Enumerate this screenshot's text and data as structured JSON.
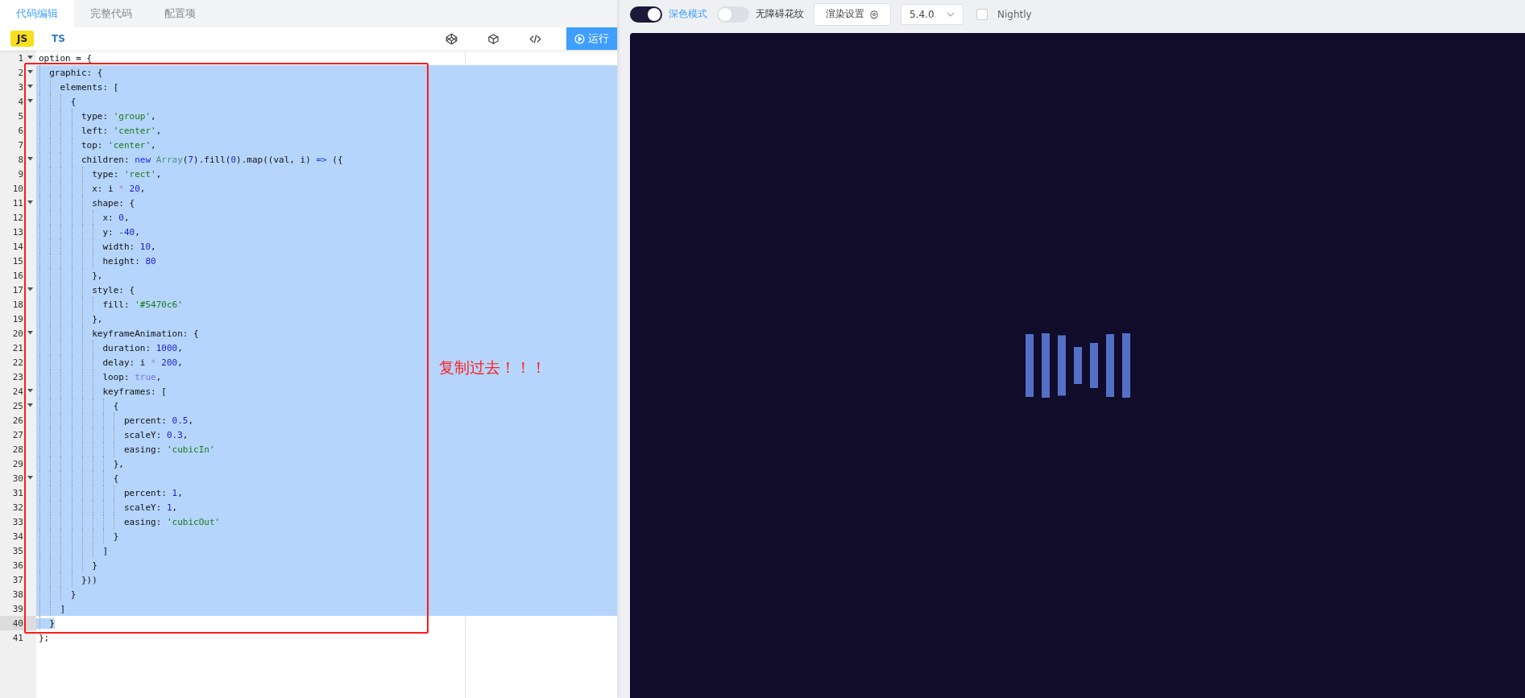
{
  "editor_tabs": [
    {
      "label": "代码编辑",
      "selected": true
    },
    {
      "label": "完整代码",
      "selected": false
    },
    {
      "label": "配置项",
      "selected": false
    }
  ],
  "languages": [
    {
      "label": "JS",
      "selected": true
    },
    {
      "label": "TS",
      "selected": false
    }
  ],
  "run_button": {
    "label": "运行"
  },
  "code_lines": [
    {
      "number": "1",
      "foldable": true,
      "selected": false,
      "cursor": false,
      "tokens": [
        {
          "kind": "plain",
          "text": "option = {"
        }
      ]
    },
    {
      "number": "2",
      "foldable": true,
      "selected": true,
      "cursor": false,
      "tokens": [
        {
          "kind": "plain",
          "text": "  graphic: {"
        }
      ]
    },
    {
      "number": "3",
      "foldable": true,
      "selected": true,
      "cursor": false,
      "tokens": [
        {
          "kind": "plain",
          "text": "    elements: ["
        }
      ]
    },
    {
      "number": "4",
      "foldable": true,
      "selected": true,
      "cursor": false,
      "tokens": [
        {
          "kind": "plain",
          "text": "      {"
        }
      ]
    },
    {
      "number": "5",
      "foldable": false,
      "selected": true,
      "cursor": false,
      "tokens": [
        {
          "kind": "plain",
          "text": "        type: "
        },
        {
          "kind": "string",
          "text": "'group'"
        },
        {
          "kind": "plain",
          "text": ","
        }
      ]
    },
    {
      "number": "6",
      "foldable": false,
      "selected": true,
      "cursor": false,
      "tokens": [
        {
          "kind": "plain",
          "text": "        left: "
        },
        {
          "kind": "string",
          "text": "'center'"
        },
        {
          "kind": "plain",
          "text": ","
        }
      ]
    },
    {
      "number": "7",
      "foldable": false,
      "selected": true,
      "cursor": false,
      "tokens": [
        {
          "kind": "plain",
          "text": "        top: "
        },
        {
          "kind": "string",
          "text": "'center'"
        },
        {
          "kind": "plain",
          "text": ","
        }
      ]
    },
    {
      "number": "8",
      "foldable": true,
      "selected": true,
      "cursor": false,
      "tokens": [
        {
          "kind": "plain",
          "text": "        children: "
        },
        {
          "kind": "keyword",
          "text": "new"
        },
        {
          "kind": "builtin",
          "text": " Array"
        },
        {
          "kind": "plain",
          "text": "("
        },
        {
          "kind": "number",
          "text": "7"
        },
        {
          "kind": "plain",
          "text": ").fill("
        },
        {
          "kind": "number",
          "text": "0"
        },
        {
          "kind": "plain",
          "text": ").map((val, i) "
        },
        {
          "kind": "keyword",
          "text": "=>"
        },
        {
          "kind": "plain",
          "text": " ({"
        }
      ]
    },
    {
      "number": "9",
      "foldable": false,
      "selected": true,
      "cursor": false,
      "tokens": [
        {
          "kind": "plain",
          "text": "          type: "
        },
        {
          "kind": "string",
          "text": "'rect'"
        },
        {
          "kind": "plain",
          "text": ","
        }
      ]
    },
    {
      "number": "10",
      "foldable": false,
      "selected": true,
      "cursor": false,
      "tokens": [
        {
          "kind": "plain",
          "text": "          x: i "
        },
        {
          "kind": "operator",
          "text": "*"
        },
        {
          "kind": "number",
          "text": " 20"
        },
        {
          "kind": "plain",
          "text": ","
        }
      ]
    },
    {
      "number": "11",
      "foldable": true,
      "selected": true,
      "cursor": false,
      "tokens": [
        {
          "kind": "plain",
          "text": "          shape: {"
        }
      ]
    },
    {
      "number": "12",
      "foldable": false,
      "selected": true,
      "cursor": false,
      "tokens": [
        {
          "kind": "plain",
          "text": "            x: "
        },
        {
          "kind": "number",
          "text": "0"
        },
        {
          "kind": "plain",
          "text": ","
        }
      ]
    },
    {
      "number": "13",
      "foldable": false,
      "selected": true,
      "cursor": false,
      "tokens": [
        {
          "kind": "plain",
          "text": "            y: "
        },
        {
          "kind": "number",
          "text": "-40"
        },
        {
          "kind": "plain",
          "text": ","
        }
      ]
    },
    {
      "number": "14",
      "foldable": false,
      "selected": true,
      "cursor": false,
      "tokens": [
        {
          "kind": "plain",
          "text": "            width: "
        },
        {
          "kind": "number",
          "text": "10"
        },
        {
          "kind": "plain",
          "text": ","
        }
      ]
    },
    {
      "number": "15",
      "foldable": false,
      "selected": true,
      "cursor": false,
      "tokens": [
        {
          "kind": "plain",
          "text": "            height: "
        },
        {
          "kind": "number",
          "text": "80"
        }
      ]
    },
    {
      "number": "16",
      "foldable": false,
      "selected": true,
      "cursor": false,
      "tokens": [
        {
          "kind": "plain",
          "text": "          },"
        }
      ]
    },
    {
      "number": "17",
      "foldable": true,
      "selected": true,
      "cursor": false,
      "tokens": [
        {
          "kind": "plain",
          "text": "          style: {"
        }
      ]
    },
    {
      "number": "18",
      "foldable": false,
      "selected": true,
      "cursor": false,
      "tokens": [
        {
          "kind": "plain",
          "text": "            fill: "
        },
        {
          "kind": "string",
          "text": "'#5470c6'"
        }
      ]
    },
    {
      "number": "19",
      "foldable": false,
      "selected": true,
      "cursor": false,
      "tokens": [
        {
          "kind": "plain",
          "text": "          },"
        }
      ]
    },
    {
      "number": "20",
      "foldable": true,
      "selected": true,
      "cursor": false,
      "tokens": [
        {
          "kind": "plain",
          "text": "          keyframeAnimation: {"
        }
      ]
    },
    {
      "number": "21",
      "foldable": false,
      "selected": true,
      "cursor": false,
      "tokens": [
        {
          "kind": "plain",
          "text": "            duration: "
        },
        {
          "kind": "number",
          "text": "1000"
        },
        {
          "kind": "plain",
          "text": ","
        }
      ]
    },
    {
      "number": "22",
      "foldable": false,
      "selected": true,
      "cursor": false,
      "tokens": [
        {
          "kind": "plain",
          "text": "            delay: i "
        },
        {
          "kind": "operator",
          "text": "*"
        },
        {
          "kind": "number",
          "text": " 200"
        },
        {
          "kind": "plain",
          "text": ","
        }
      ]
    },
    {
      "number": "23",
      "foldable": false,
      "selected": true,
      "cursor": false,
      "tokens": [
        {
          "kind": "plain",
          "text": "            loop: "
        },
        {
          "kind": "constant",
          "text": "true"
        },
        {
          "kind": "plain",
          "text": ","
        }
      ]
    },
    {
      "number": "24",
      "foldable": true,
      "selected": true,
      "cursor": false,
      "tokens": [
        {
          "kind": "plain",
          "text": "            keyframes: ["
        }
      ]
    },
    {
      "number": "25",
      "foldable": true,
      "selected": true,
      "cursor": false,
      "tokens": [
        {
          "kind": "plain",
          "text": "              {"
        }
      ]
    },
    {
      "number": "26",
      "foldable": false,
      "selected": true,
      "cursor": false,
      "tokens": [
        {
          "kind": "plain",
          "text": "                percent: "
        },
        {
          "kind": "number",
          "text": "0.5"
        },
        {
          "kind": "plain",
          "text": ","
        }
      ]
    },
    {
      "number": "27",
      "foldable": false,
      "selected": true,
      "cursor": false,
      "tokens": [
        {
          "kind": "plain",
          "text": "                scaleY: "
        },
        {
          "kind": "number",
          "text": "0.3"
        },
        {
          "kind": "plain",
          "text": ","
        }
      ]
    },
    {
      "number": "28",
      "foldable": false,
      "selected": true,
      "cursor": false,
      "tokens": [
        {
          "kind": "plain",
          "text": "                easing: "
        },
        {
          "kind": "string",
          "text": "'cubicIn'"
        }
      ]
    },
    {
      "number": "29",
      "foldable": false,
      "selected": true,
      "cursor": false,
      "tokens": [
        {
          "kind": "plain",
          "text": "              },"
        }
      ]
    },
    {
      "number": "30",
      "foldable": true,
      "selected": true,
      "cursor": false,
      "tokens": [
        {
          "kind": "plain",
          "text": "              {"
        }
      ]
    },
    {
      "number": "31",
      "foldable": false,
      "selected": true,
      "cursor": false,
      "tokens": [
        {
          "kind": "plain",
          "text": "                percent: "
        },
        {
          "kind": "number",
          "text": "1"
        },
        {
          "kind": "plain",
          "text": ","
        }
      ]
    },
    {
      "number": "32",
      "foldable": false,
      "selected": true,
      "cursor": false,
      "tokens": [
        {
          "kind": "plain",
          "text": "                scaleY: "
        },
        {
          "kind": "number",
          "text": "1"
        },
        {
          "kind": "plain",
          "text": ","
        }
      ]
    },
    {
      "number": "33",
      "foldable": false,
      "selected": true,
      "cursor": false,
      "tokens": [
        {
          "kind": "plain",
          "text": "                easing: "
        },
        {
          "kind": "string",
          "text": "'cubicOut'"
        }
      ]
    },
    {
      "number": "34",
      "foldable": false,
      "selected": true,
      "cursor": false,
      "tokens": [
        {
          "kind": "plain",
          "text": "              }"
        }
      ]
    },
    {
      "number": "35",
      "foldable": false,
      "selected": true,
      "cursor": false,
      "tokens": [
        {
          "kind": "plain",
          "text": "            ]"
        }
      ]
    },
    {
      "number": "36",
      "foldable": false,
      "selected": true,
      "cursor": false,
      "tokens": [
        {
          "kind": "plain",
          "text": "          }"
        }
      ]
    },
    {
      "number": "37",
      "foldable": false,
      "selected": true,
      "cursor": false,
      "tokens": [
        {
          "kind": "plain",
          "text": "        }))"
        }
      ]
    },
    {
      "number": "38",
      "foldable": false,
      "selected": true,
      "cursor": false,
      "tokens": [
        {
          "kind": "plain",
          "text": "      }"
        }
      ]
    },
    {
      "number": "39",
      "foldable": false,
      "selected": true,
      "cursor": false,
      "tokens": [
        {
          "kind": "plain",
          "text": "    ]"
        }
      ]
    },
    {
      "number": "40",
      "foldable": false,
      "selected": true,
      "cursor": true,
      "tokens": [
        {
          "kind": "plain",
          "text": "  }"
        }
      ]
    },
    {
      "number": "41",
      "foldable": false,
      "selected": false,
      "cursor": false,
      "tokens": [
        {
          "kind": "plain",
          "text": "};"
        }
      ]
    }
  ],
  "annotation": {
    "text": "复制过去！！！"
  },
  "preview_toolbar": {
    "dark_mode": {
      "label": "深色模式",
      "on": true
    },
    "accessible_pattern": {
      "label": "无障碍花纹",
      "on": false
    },
    "render_settings": {
      "label": "渲染设置"
    },
    "version": {
      "value": "5.4.0"
    },
    "nightly": {
      "label": "Nightly",
      "checked": false
    }
  }
}
